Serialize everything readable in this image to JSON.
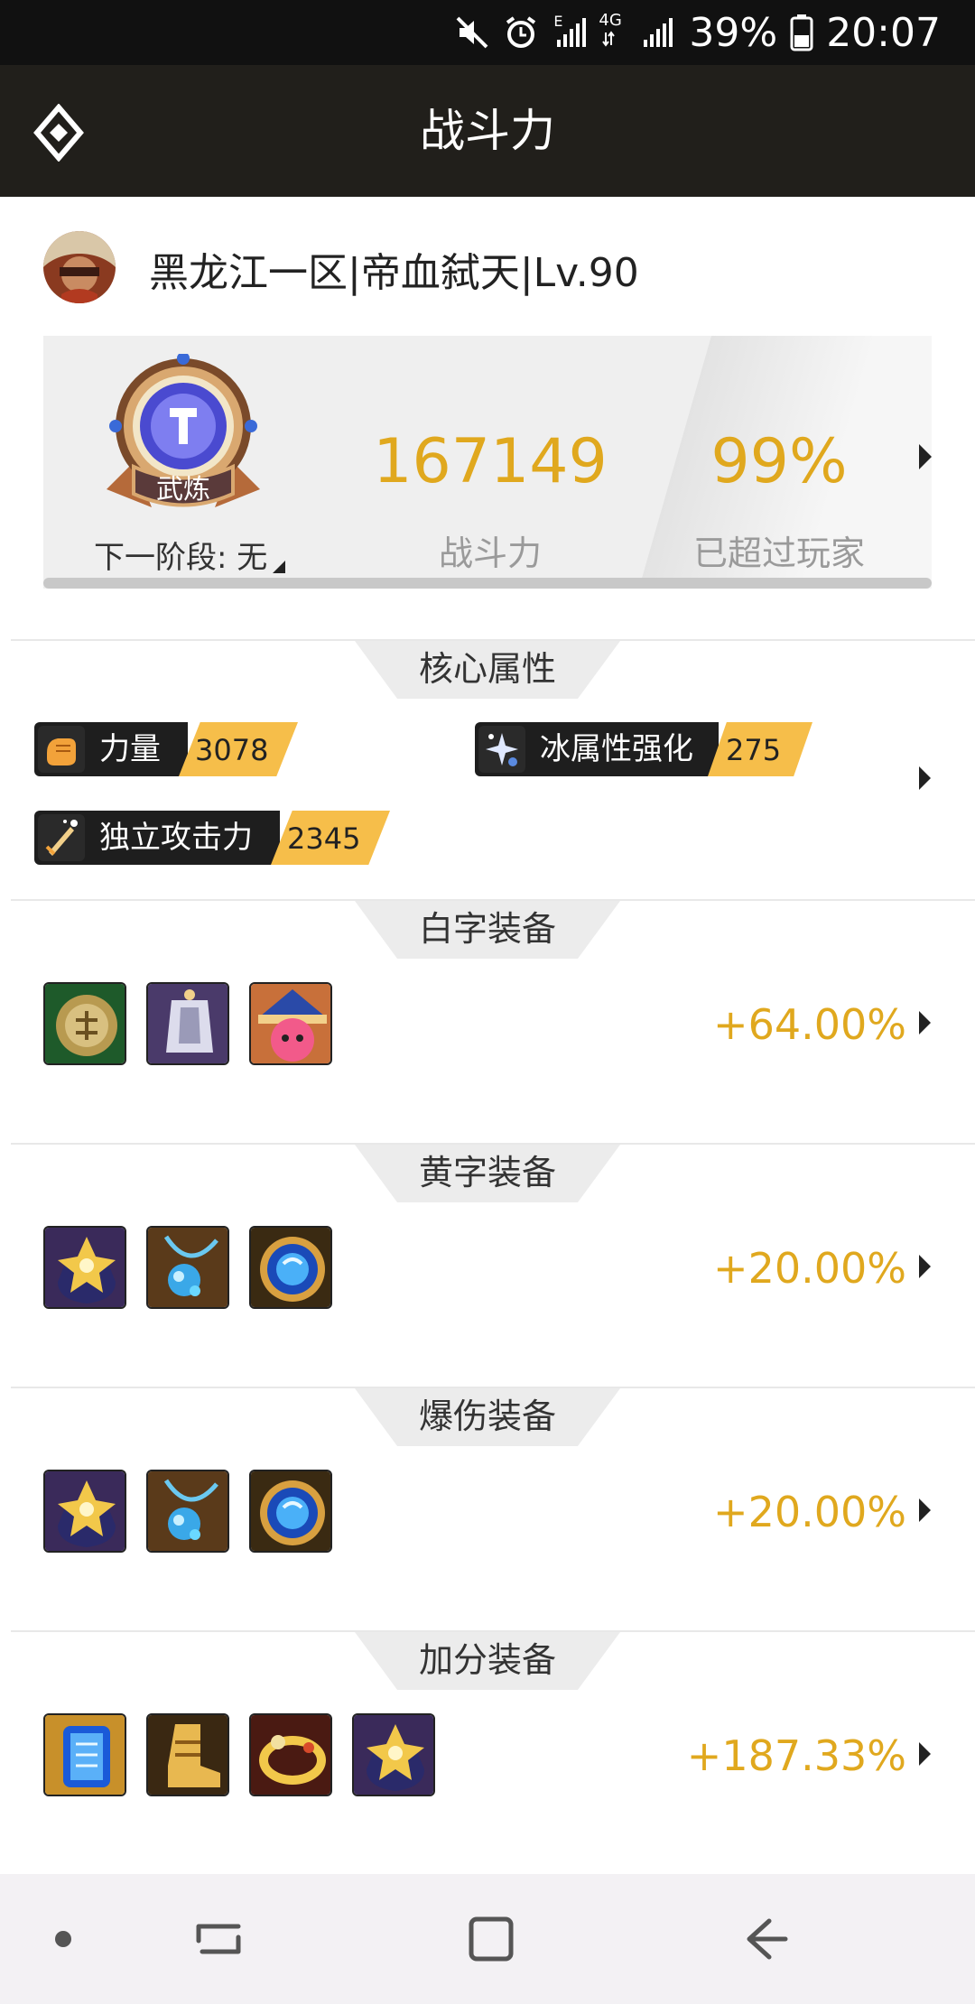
{
  "status_bar": {
    "battery": "39%",
    "time": "20:07",
    "network_label": "4G",
    "signal_label": "E",
    "icons": [
      "mute-icon",
      "alarm-icon",
      "signal-icon",
      "4g-signal-icon",
      "battery-icon"
    ]
  },
  "header": {
    "title": "战斗力",
    "back_icon": "diamond-back-icon"
  },
  "user": {
    "name": "黑龙江一区|帝血弑天|Lv.90"
  },
  "power": {
    "badge_label": "武炼",
    "next_stage": "下一阶段: 无",
    "value": "167149",
    "value_label": "战斗力",
    "percent": "99%",
    "percent_label": "已超过玩家"
  },
  "core_attributes": {
    "title": "核心属性",
    "items": [
      {
        "name": "力量",
        "value": "3078",
        "icon": "strength-fist-icon"
      },
      {
        "name": "冰属性强化",
        "value": "275",
        "icon": "ice-sparkle-icon"
      },
      {
        "name": "独立攻击力",
        "value": "2345",
        "icon": "sword-sparkle-icon"
      }
    ]
  },
  "sections": [
    {
      "title": "白字装备",
      "bonus": "+64.00%",
      "items": [
        "lion-shield-icon",
        "silver-armor-icon",
        "pink-hat-icon"
      ]
    },
    {
      "title": "黄字装备",
      "bonus": "+20.00%",
      "items": [
        "gold-gem-icon",
        "blue-necklace-icon",
        "blue-orb-icon"
      ]
    },
    {
      "title": "爆伤装备",
      "bonus": "+20.00%",
      "items": [
        "gold-gem-icon",
        "blue-necklace-icon",
        "blue-orb-icon"
      ]
    },
    {
      "title": "加分装备",
      "bonus": "+187.33%",
      "items": [
        "blue-scroll-icon",
        "gold-boot-icon",
        "gold-bracelet-icon",
        "gold-gem-icon"
      ]
    }
  ],
  "colors": {
    "accent": "#e0a81e",
    "header_bg": "#211f1b",
    "status_bg": "#111111",
    "pill_value_bg": "#f6be4a"
  },
  "nav_bar": {
    "icons": [
      "dot-icon",
      "recent-apps-icon",
      "home-square-icon",
      "back-arrow-icon"
    ]
  }
}
